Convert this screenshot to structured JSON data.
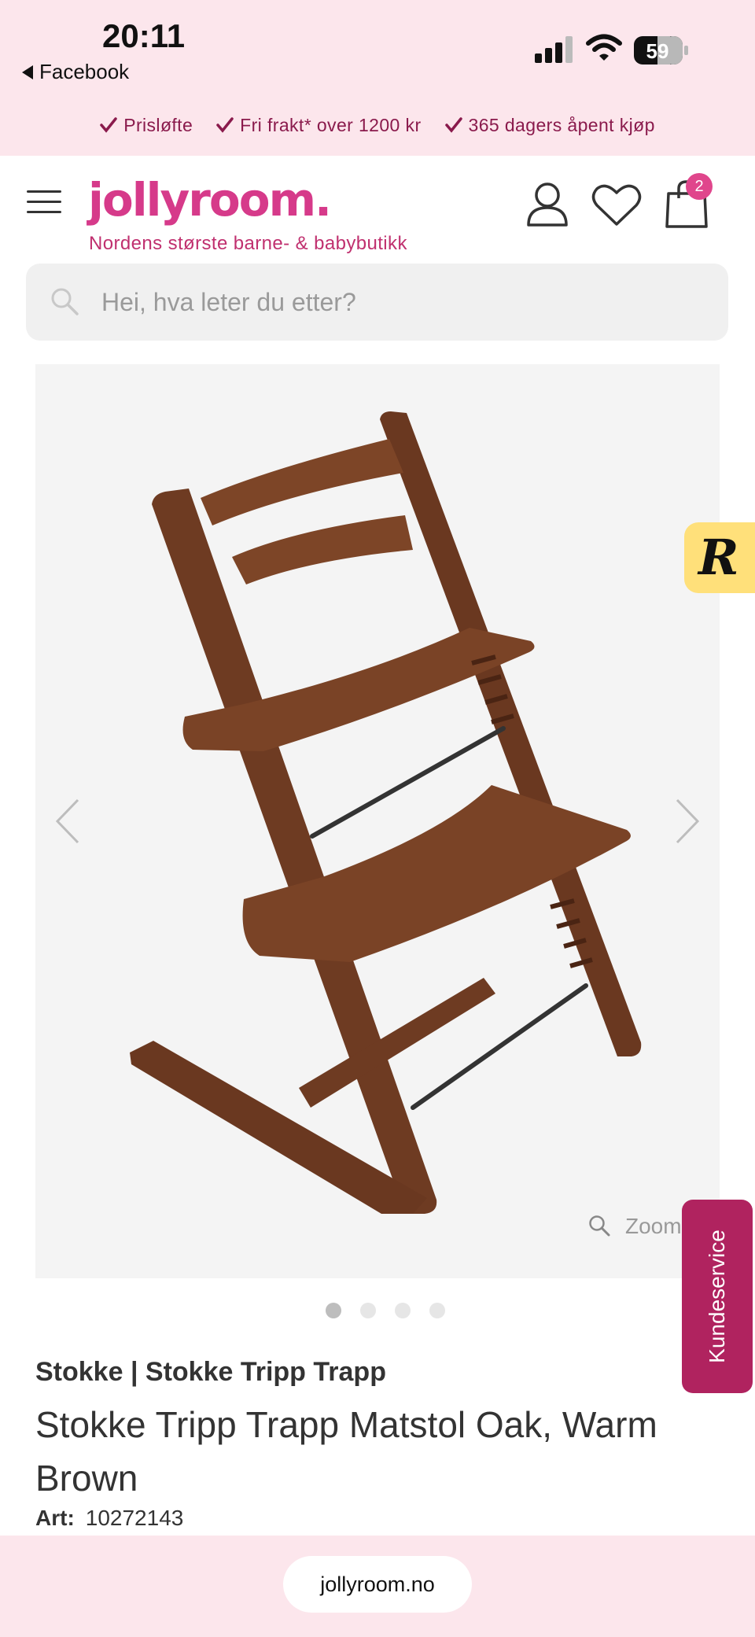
{
  "status_bar": {
    "time": "20:11",
    "back_app": "Facebook",
    "battery": "59"
  },
  "promo": {
    "items": [
      "Prisløfte",
      "Fri frakt* over 1200 kr",
      "365 dagers åpent kjøp"
    ]
  },
  "header": {
    "logo": "jollyroom.",
    "tagline": "Nordens største barne- & babybutikk",
    "cart_count": "2"
  },
  "search": {
    "placeholder": "Hei, hva leter du etter?"
  },
  "gallery": {
    "zoom_label": "Zoom",
    "current_slide": 1,
    "slide_count": 4
  },
  "product": {
    "brand_line": "Stokke | Stokke Tripp Trapp",
    "title": "Stokke Tripp Trapp Matstol Oak, Warm Brown",
    "art_label": "Art:",
    "art_number": "10272143"
  },
  "widgets": {
    "reviews_letter": "R",
    "customer_service": "Kundeservice"
  },
  "browser": {
    "url": "jollyroom.no"
  },
  "colors": {
    "brand_pink": "#d63a8a",
    "promo_text": "#8a1a4c",
    "bar_background": "#fce6ec",
    "customer_service": "#b0235f",
    "reviews_widget": "#ffe07a"
  }
}
